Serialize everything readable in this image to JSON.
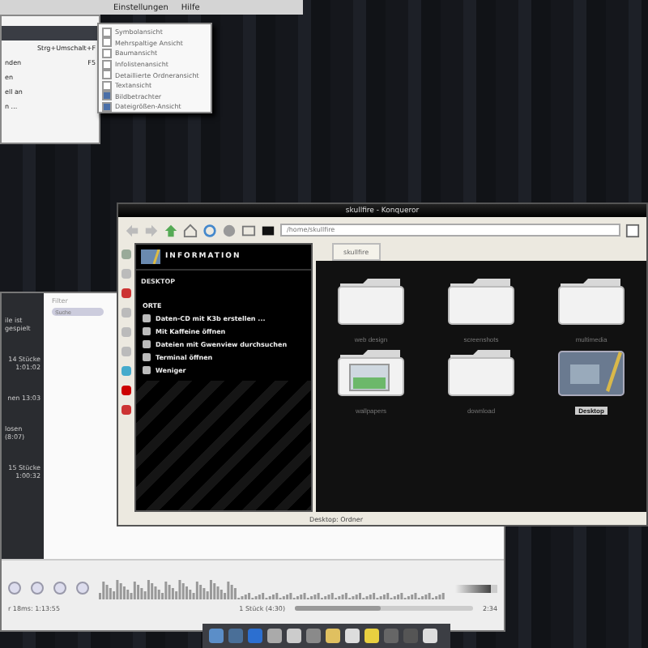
{
  "menubar": {
    "items": [
      "Einstellungen",
      "Hilfe"
    ]
  },
  "menu": {
    "items": [
      {
        "selected": true
      },
      {
        "shortcut": "Strg+Umschalt+F",
        "selected": false
      },
      {
        "label": "nden",
        "shortcut": "F5",
        "selected": false
      },
      {
        "label": "en",
        "selected": false
      },
      {
        "label": "ell an",
        "selected": false
      },
      {
        "label": "n ...",
        "selected": false
      }
    ]
  },
  "submenu": {
    "items": [
      {
        "label": "Symbolansicht",
        "checked": false
      },
      {
        "label": "Mehrspaltige Ansicht",
        "checked": false
      },
      {
        "label": "Baumansicht",
        "checked": false
      },
      {
        "label": "Infolistenansicht",
        "checked": false
      },
      {
        "label": "Detaillierte Ordneransicht",
        "checked": false
      },
      {
        "label": "Textansicht",
        "checked": false
      },
      {
        "label": "Bildbetrachter",
        "checked": true
      },
      {
        "label": "Dateigrößen-Ansicht",
        "checked": true
      }
    ]
  },
  "player": {
    "left_panel": [
      {
        "title": "ile ist gespielt"
      },
      {
        "title": "14 Stücke",
        "detail": "1:01:02"
      },
      {
        "title": "nen 13:03"
      },
      {
        "title": "losen (8:07)"
      },
      {
        "title": "15 Stücke",
        "detail": "1:00:32"
      }
    ],
    "filter_label": "Filter",
    "search_placeholder": "Suche",
    "status_left": "r 18ms: 1:13:55",
    "track_count": "1 Stück (4:30)",
    "time": "2:34",
    "progress": {
      "level": 0.48
    },
    "volume": {
      "level": 0.85
    }
  },
  "konqueror": {
    "title": "skullfire - Konqueror",
    "location": "/home/skullfire",
    "tab": "skullfire",
    "sidebar": {
      "header": "INFORMATION",
      "subheader": "DESKTOP",
      "section": "ORTE",
      "actions": [
        "Daten-CD mit K3b erstellen ...",
        "Mit Kaffeine öffnen",
        "Dateien mit Gwenview durchsuchen",
        "Terminal öffnen",
        "Weniger"
      ]
    },
    "files": [
      {
        "name": "web design",
        "kind": "folder",
        "selected": false
      },
      {
        "name": "screenshots",
        "kind": "folder",
        "selected": false
      },
      {
        "name": "multimedia",
        "kind": "folder",
        "selected": false
      },
      {
        "name": "wallpapers",
        "kind": "images",
        "selected": false
      },
      {
        "name": "download",
        "kind": "folder",
        "selected": false
      },
      {
        "name": "Desktop",
        "kind": "desktop",
        "selected": true
      }
    ],
    "status": "Desktop: Ordner"
  }
}
